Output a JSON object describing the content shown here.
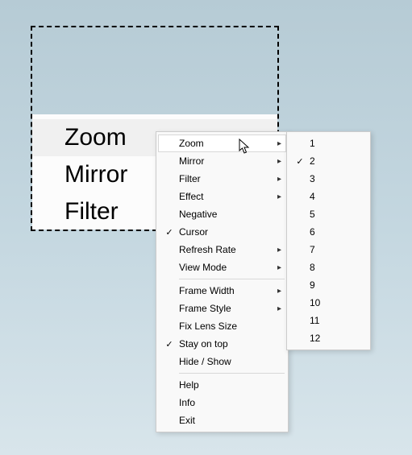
{
  "lens": {
    "magnified_items": [
      "Zoom",
      "Mirror",
      "Filter"
    ],
    "highlighted_index": 0
  },
  "context_menu": {
    "highlighted_index": 0,
    "sections": [
      [
        {
          "label": "Zoom",
          "has_submenu": true,
          "checked": false
        },
        {
          "label": "Mirror",
          "has_submenu": true,
          "checked": false
        },
        {
          "label": "Filter",
          "has_submenu": true,
          "checked": false
        },
        {
          "label": "Effect",
          "has_submenu": true,
          "checked": false
        },
        {
          "label": "Negative",
          "has_submenu": false,
          "checked": false
        },
        {
          "label": "Cursor",
          "has_submenu": false,
          "checked": true
        },
        {
          "label": "Refresh Rate",
          "has_submenu": true,
          "checked": false
        },
        {
          "label": "View Mode",
          "has_submenu": true,
          "checked": false
        }
      ],
      [
        {
          "label": "Frame Width",
          "has_submenu": true,
          "checked": false
        },
        {
          "label": "Frame Style",
          "has_submenu": true,
          "checked": false
        },
        {
          "label": "Fix Lens Size",
          "has_submenu": false,
          "checked": false
        },
        {
          "label": "Stay on top",
          "has_submenu": false,
          "checked": true
        },
        {
          "label": "Hide / Show",
          "has_submenu": false,
          "checked": false
        }
      ],
      [
        {
          "label": "Help",
          "has_submenu": false,
          "checked": false
        },
        {
          "label": "Info",
          "has_submenu": false,
          "checked": false
        },
        {
          "label": "Exit",
          "has_submenu": false,
          "checked": false
        }
      ]
    ]
  },
  "zoom_submenu": {
    "checked_value": "2",
    "items": [
      "1",
      "2",
      "3",
      "4",
      "5",
      "6",
      "7",
      "8",
      "9",
      "10",
      "11",
      "12"
    ]
  }
}
